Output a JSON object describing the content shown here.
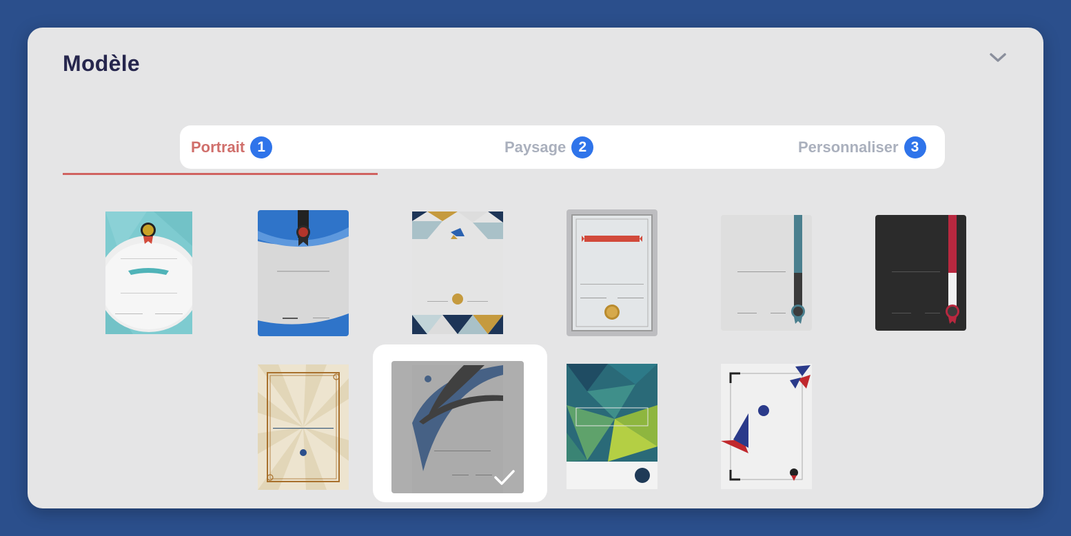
{
  "panel": {
    "title": "Modèle",
    "collapse_icon": "chevron-down-icon"
  },
  "tabs": [
    {
      "label": "Portrait",
      "badge": "1",
      "active": true
    },
    {
      "label": "Paysage",
      "badge": "2",
      "active": false
    },
    {
      "label": "Personnaliser",
      "badge": "3",
      "active": false
    }
  ],
  "colors": {
    "background": "#2b4f8c",
    "card": "#e5e5e6",
    "active_tab": "#d06f6b",
    "badge": "#2f74ea",
    "title": "#26264d"
  },
  "templates": [
    {
      "name": "template-teal-ribbon",
      "style": "teal-arc",
      "selected": false
    },
    {
      "name": "template-blue-medal",
      "style": "blue-wave",
      "selected": false
    },
    {
      "name": "template-geometric-gold",
      "style": "triangles",
      "selected": false
    },
    {
      "name": "template-silver-frame",
      "style": "silver-frame",
      "selected": false
    },
    {
      "name": "template-grey-teal-band",
      "style": "teal-band",
      "selected": false
    },
    {
      "name": "template-black-red-band",
      "style": "red-band",
      "selected": false
    },
    {
      "name": "template-vintage-sunburst",
      "style": "sunburst",
      "selected": false
    },
    {
      "name": "template-blue-swoosh",
      "style": "swoosh",
      "selected": true
    },
    {
      "name": "template-polygon-green",
      "style": "polygon",
      "selected": false
    },
    {
      "name": "template-tricolor-corners",
      "style": "tricolor",
      "selected": false
    }
  ]
}
